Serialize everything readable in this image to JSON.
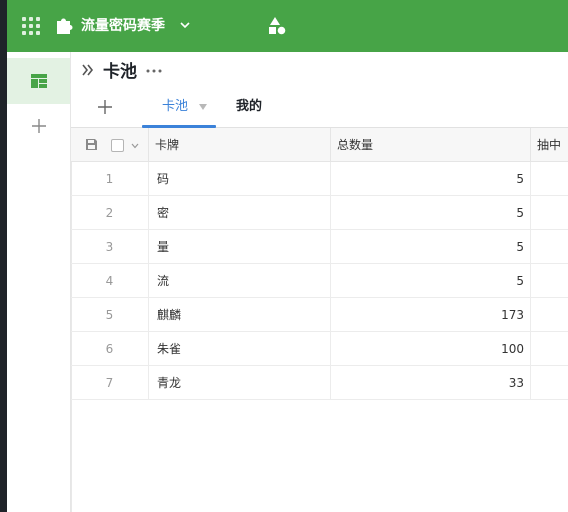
{
  "topbar": {
    "title": "流量密码赛季",
    "bg_color": "#47a447",
    "icons": [
      "apps-grid-icon",
      "puzzle-icon",
      "chevron-down-icon",
      "shapes-icon"
    ]
  },
  "sidebar": {
    "active_item": "board-icon",
    "add_icon": "plus-icon",
    "active_bg": "#e3f2e3"
  },
  "header": {
    "title": "卡池",
    "tabs": [
      {
        "label": "卡池",
        "active": true
      },
      {
        "label": "我的",
        "active": false
      }
    ],
    "accent_color": "#3b82d9"
  },
  "table": {
    "columns": [
      "卡牌",
      "总数量",
      "抽中"
    ],
    "rows": [
      {
        "no": "1",
        "card": "码",
        "qty": "5"
      },
      {
        "no": "2",
        "card": "密",
        "qty": "5"
      },
      {
        "no": "3",
        "card": "量",
        "qty": "5"
      },
      {
        "no": "4",
        "card": "流",
        "qty": "5"
      },
      {
        "no": "5",
        "card": "麒麟",
        "qty": "173"
      },
      {
        "no": "6",
        "card": "朱雀",
        "qty": "100"
      },
      {
        "no": "7",
        "card": "青龙",
        "qty": "33"
      }
    ]
  }
}
